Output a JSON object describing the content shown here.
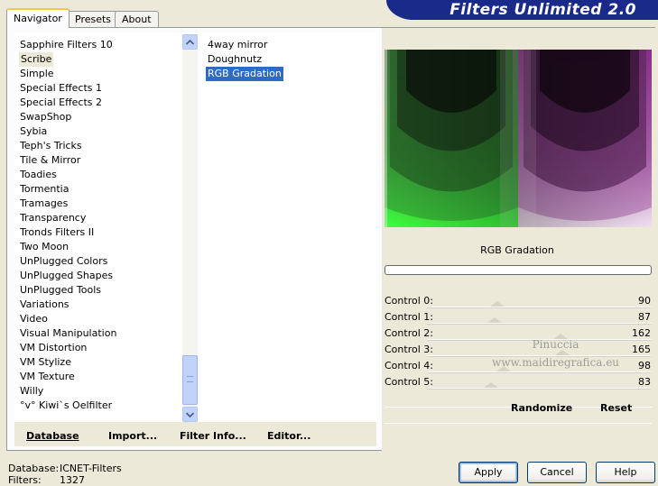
{
  "tabs": [
    {
      "label": "Navigator",
      "active": true
    },
    {
      "label": "Presets",
      "active": false
    },
    {
      "label": "About",
      "active": false
    }
  ],
  "app_title": "Filters Unlimited 2.0",
  "categories": [
    "Sapphire Filters 10",
    "Scribe",
    "Simple",
    "Special Effects 1",
    "Special Effects 2",
    "SwapShop",
    "Sybia",
    "Teph's Tricks",
    "Tile & Mirror",
    "Toadies",
    "Tormentia",
    "Tramages",
    "Transparency",
    "Tronds Filters II",
    "Two Moon",
    "UnPlugged Colors",
    "UnPlugged Shapes",
    "UnPlugged Tools",
    "Variations",
    "Video",
    "Visual Manipulation",
    "VM Distortion",
    "VM Stylize",
    "VM Texture",
    "Willy",
    "°v° Kiwi`s Oelfilter"
  ],
  "selected_category": "Scribe",
  "filters": [
    "4way mirror",
    "Doughnutz",
    "RGB Gradation"
  ],
  "selected_filter": "RGB Gradation",
  "filter_title": "RGB Gradation",
  "controls": [
    {
      "label": "Control 0:",
      "value": 90
    },
    {
      "label": "Control 1:",
      "value": 87
    },
    {
      "label": "Control 2:",
      "value": 162
    },
    {
      "label": "Control 3:",
      "value": 165
    },
    {
      "label": "Control 4:",
      "value": 98
    },
    {
      "label": "Control 5:",
      "value": 83
    }
  ],
  "toolbar": {
    "database": "Database",
    "import": "Import...",
    "filter_info": "Filter Info...",
    "editor": "Editor...",
    "randomize": "Randomize",
    "reset": "Reset"
  },
  "status": {
    "database_label": "Database:",
    "database_value": "ICNET-Filters",
    "filters_label": "Filters:",
    "filters_value": "1327"
  },
  "buttons": {
    "apply": "Apply",
    "cancel": "Cancel",
    "help": "Help"
  },
  "watermark": {
    "line1": "Pinuccia",
    "line2": "www.maidiregrafica.eu"
  }
}
